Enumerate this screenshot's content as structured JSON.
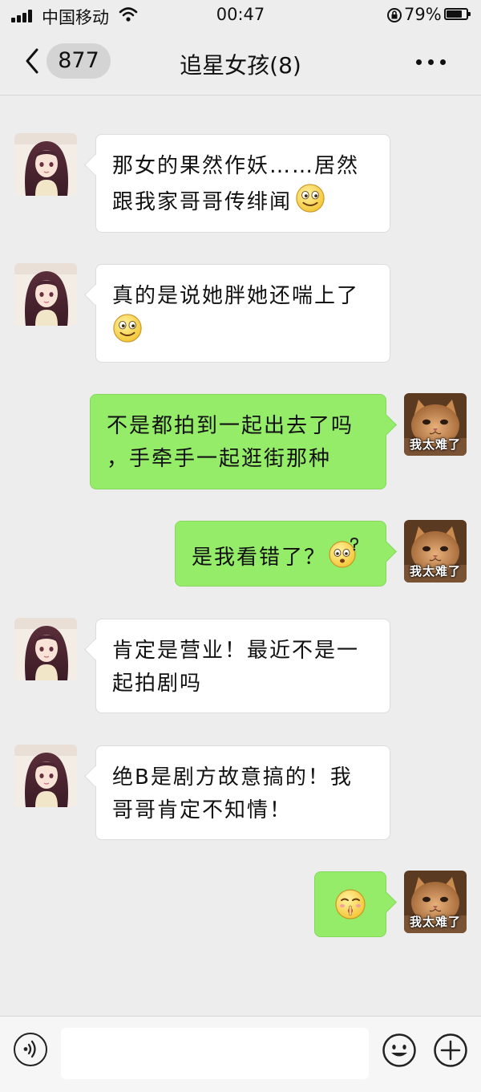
{
  "status_bar": {
    "carrier": "中国移动",
    "time": "00:47",
    "battery_percent": "79%",
    "battery_level": 0.79
  },
  "nav": {
    "unread_count": "877",
    "title": "追星女孩(8)"
  },
  "messages": [
    {
      "side": "left",
      "text_lines": [
        "那女的果然作妖……居然",
        "跟我家哥哥传绯闻"
      ],
      "emoji": "smile-emoji"
    },
    {
      "side": "left",
      "text_lines": [
        "真的是说她胖她还喘上了"
      ],
      "emoji": "smile-emoji"
    },
    {
      "side": "right",
      "text_lines": [
        "不是都拍到一起出去了吗",
        "，手牵手一起逛街那种"
      ],
      "avatar_caption": "我太难了"
    },
    {
      "side": "right",
      "text_lines": [
        "是我看错了？"
      ],
      "emoji": "question-emoji",
      "avatar_caption": "我太难了"
    },
    {
      "side": "left",
      "text_lines": [
        "肯定是营业！最近不是一",
        "起拍剧吗"
      ]
    },
    {
      "side": "left",
      "text_lines": [
        "绝B是剧方故意搞的！我",
        "哥哥肯定不知情！"
      ]
    },
    {
      "side": "right",
      "text_lines": [],
      "emoji": "shush-emoji",
      "avatar_caption": "我太难了"
    }
  ],
  "input_bar": {
    "placeholder": ""
  },
  "colors": {
    "background": "#ededed",
    "my_bubble": "#95ec69",
    "other_bubble": "#ffffff"
  }
}
